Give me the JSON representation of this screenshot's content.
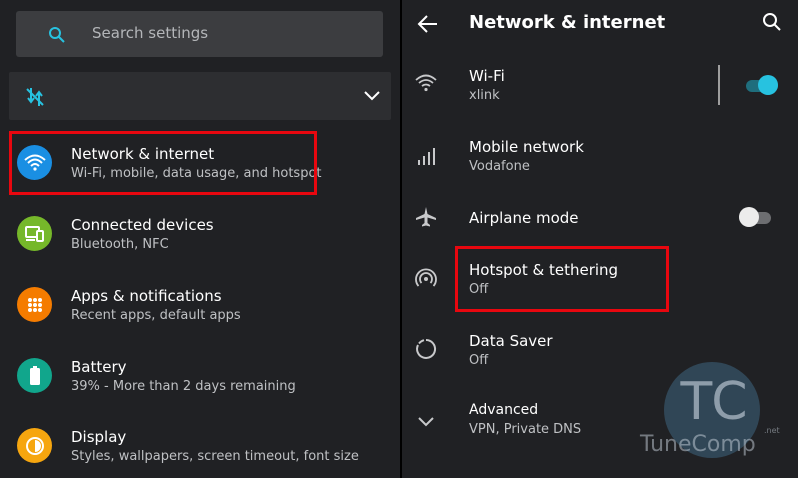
{
  "search": {
    "placeholder": "Search settings"
  },
  "settings_list": [
    {
      "title": "Network & internet",
      "subtitle": "Wi-Fi, mobile, data usage, and hotspot",
      "icon": "wifi-icon",
      "color": "#1a8fe3"
    },
    {
      "title": "Connected devices",
      "subtitle": "Bluetooth, NFC",
      "icon": "devices-icon",
      "color": "#76b82a"
    },
    {
      "title": "Apps & notifications",
      "subtitle": "Recent apps, default apps",
      "icon": "apps-icon",
      "color": "#f57c00"
    },
    {
      "title": "Battery",
      "subtitle": "39% - More than 2 days remaining",
      "icon": "battery-icon",
      "color": "#11a68c"
    },
    {
      "title": "Display",
      "subtitle": "Styles, wallpapers, screen timeout, font size",
      "icon": "display-icon",
      "color": "#f6a60f"
    }
  ],
  "network_page": {
    "title": "Network & internet",
    "items": [
      {
        "title": "Wi-Fi",
        "subtitle": "xlink",
        "icon": "wifi-icon",
        "toggle": true
      },
      {
        "title": "Mobile network",
        "subtitle": "Vodafone",
        "icon": "signal-icon"
      },
      {
        "title": "Airplane mode",
        "subtitle": "",
        "icon": "airplane-icon",
        "toggle": false
      },
      {
        "title": "Hotspot & tethering",
        "subtitle": "Off",
        "icon": "hotspot-icon"
      },
      {
        "title": "Data Saver",
        "subtitle": "Off",
        "icon": "data-saver-icon"
      },
      {
        "title": "Advanced",
        "subtitle": "VPN, Private DNS",
        "icon": "chevron-down-icon"
      }
    ]
  },
  "colors": {
    "accent": "#27c2e0",
    "highlight": "#e8070f",
    "background": "#202124"
  },
  "watermark": {
    "logo": "TC",
    "name": "TuneComp",
    "tld": ".net"
  }
}
